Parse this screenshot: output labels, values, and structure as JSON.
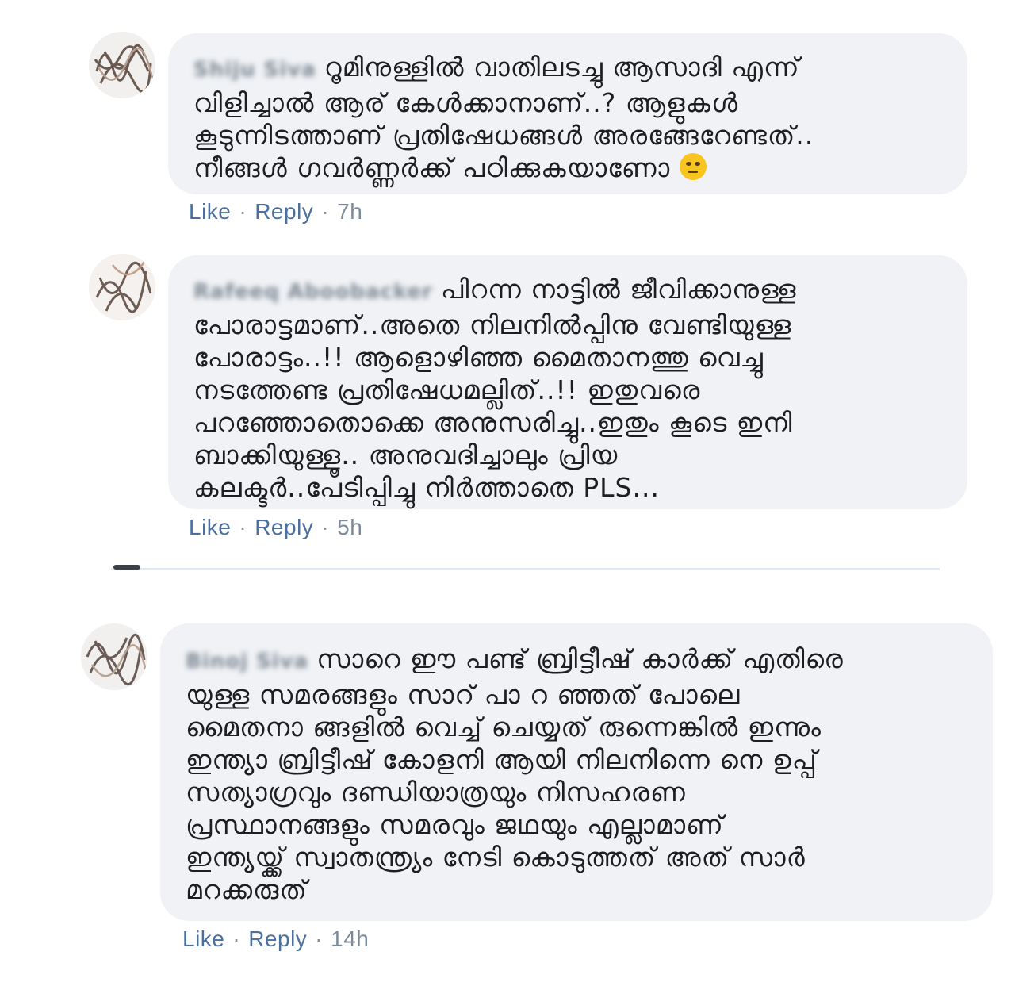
{
  "comments": [
    {
      "author": "Shiju Siva",
      "text": "റൂമിനുള്ളിൽ വാതിലടച്ചു ആസാദി എന്ന്\nവിളിച്ചാൽ ആര് കേൾക്കാനാണ്..? ആളുകൾ\nകൂടുന്നിടത്താണ് പ്രതിഷേധങ്ങൾ അരങ്ങേറേണ്ടത്..\nനീങ്ങൾ ഗവർണ്ണർക്ക് പഠിക്കുകയാണോ",
      "emoji": "eye-roll-emoji",
      "like_label": "Like",
      "reply_label": "Reply",
      "time": "7h"
    },
    {
      "author": "Rafeeq Aboobacker",
      "text": "പിറന്ന നാട്ടിൽ ജീവിക്കാനുള്ള\nപോരാട്ടമാണ്..അതെ നിലനിൽപ്പിനു വേണ്ടിയുള്ള\nപോരാട്ടം..!! ആളൊഴിഞ്ഞ മൈതാനത്തു വെച്ചു\nനടത്തേണ്ട പ്രതിഷേധമല്ലിത്..!! ഇതുവരെ\nപറഞ്ഞോതൊക്കെ അനുസരിച്ചു..ഇതും കൂടെ ഇനി\nബാക്കിയുള്ളൂ.. അനുവദിച്ചാലും പ്രിയ\nകലക്ടർ..പേടിപ്പിച്ചു നിർത്താതെ PLS...",
      "like_label": "Like",
      "reply_label": "Reply",
      "time": "5h"
    },
    {
      "author": "Binoj Siva",
      "text": "സാറെ ഈ പണ്ട് ബ്രിട്ടീഷ് കാർക്ക് എതിരെ\nയുള്ള സമരങ്ങളും സാറ് പാ റ ഞ്ഞത് പോലെ\nമൈതനാ ങ്ങളിൽ വെച്ച് ചെയ്യത് രുന്നെങ്കിൽ ഇന്നും\nഇന്ത്യാ ബ്രിട്ടീഷ് കോളനി ആയി നിലനിന്നെ നെ ഉപ്പ്\nസത്യാഗ്രവും ദണ്ഡിയാത്രയും നിസഹരണ\nപ്രസ്ഥാനങ്ങളും സമരവും ജഥയും എല്ലാമാണ്\nഇന്ത്യയ്ക്ക് സ്വാതന്ത്ര്യം നേടി കൊടുത്തത് അത് സാർ\nമറക്കരുത്",
      "like_label": "Like",
      "reply_label": "Reply",
      "time": "14h"
    }
  ],
  "separator": "·",
  "colors": {
    "bubble": "#f0f2f5",
    "link": "#4b6f9e",
    "text": "#1c1e21"
  }
}
